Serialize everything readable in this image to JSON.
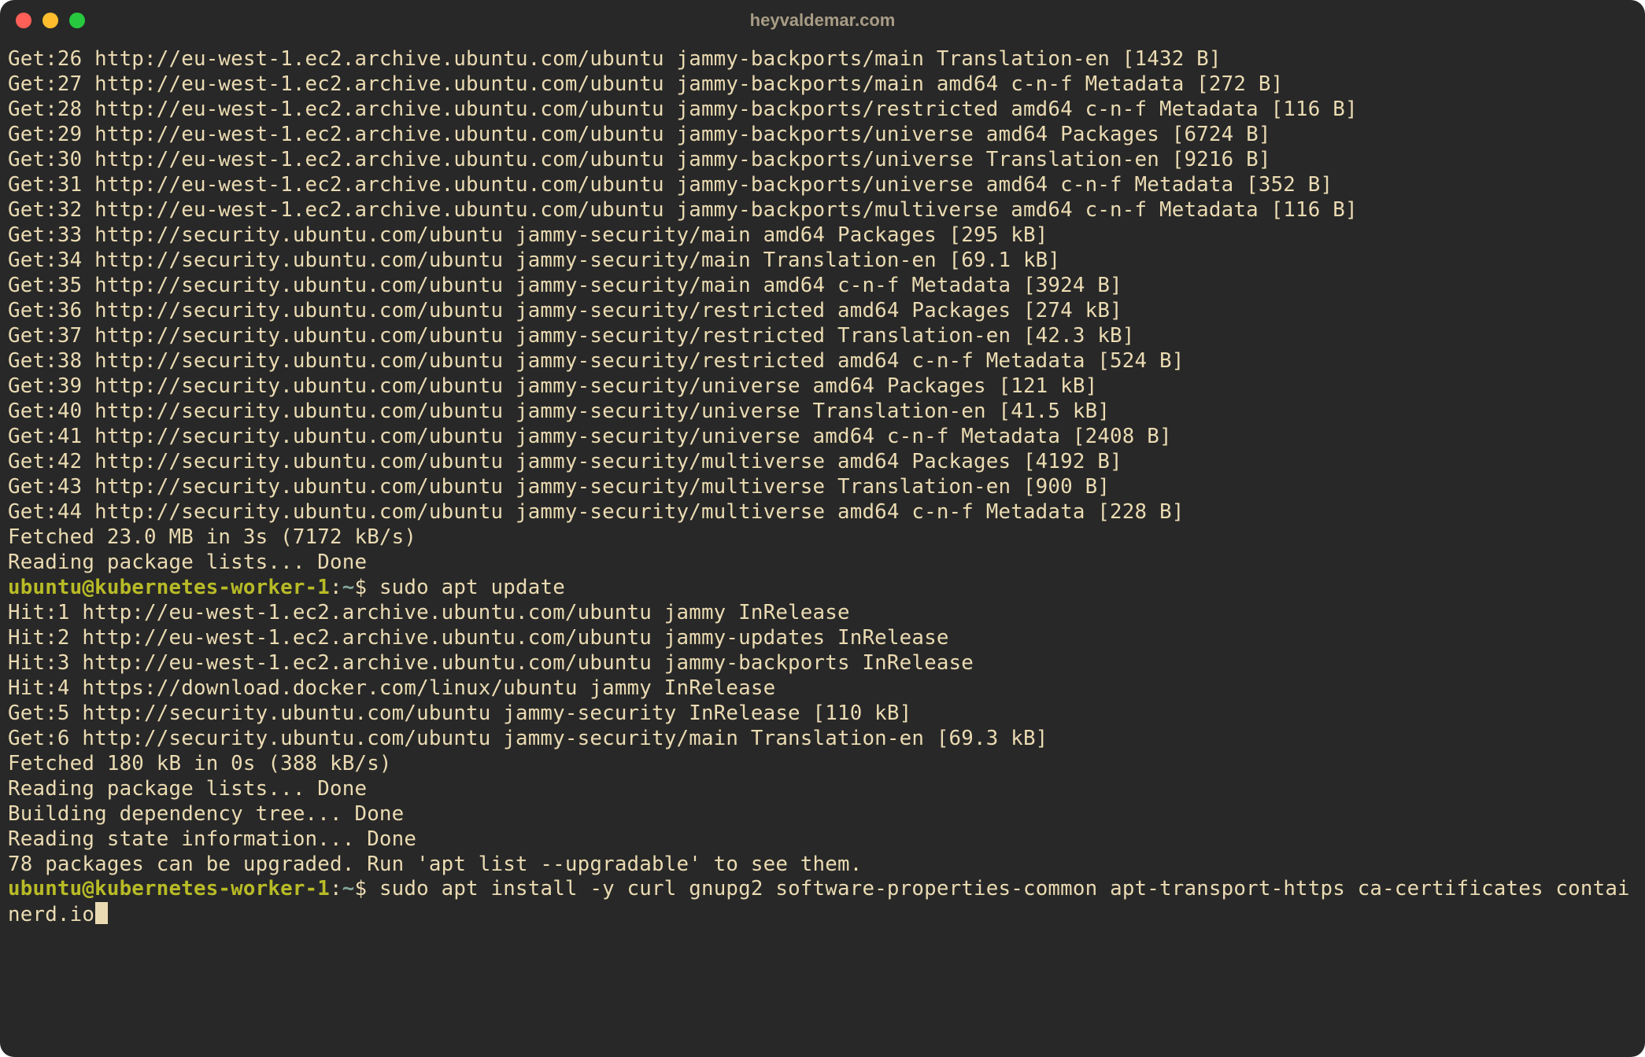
{
  "window": {
    "title": "heyvaldemar.com"
  },
  "prompt": {
    "user_host": "ubuntu@kubernetes-worker-1",
    "colon": ":",
    "path": "~",
    "symbol": "$"
  },
  "lines": [
    {
      "t": "out",
      "text": "Get:26 http://eu-west-1.ec2.archive.ubuntu.com/ubuntu jammy-backports/main Translation-en [1432 B]"
    },
    {
      "t": "out",
      "text": "Get:27 http://eu-west-1.ec2.archive.ubuntu.com/ubuntu jammy-backports/main amd64 c-n-f Metadata [272 B]"
    },
    {
      "t": "out",
      "text": "Get:28 http://eu-west-1.ec2.archive.ubuntu.com/ubuntu jammy-backports/restricted amd64 c-n-f Metadata [116 B]"
    },
    {
      "t": "out",
      "text": "Get:29 http://eu-west-1.ec2.archive.ubuntu.com/ubuntu jammy-backports/universe amd64 Packages [6724 B]"
    },
    {
      "t": "out",
      "text": "Get:30 http://eu-west-1.ec2.archive.ubuntu.com/ubuntu jammy-backports/universe Translation-en [9216 B]"
    },
    {
      "t": "out",
      "text": "Get:31 http://eu-west-1.ec2.archive.ubuntu.com/ubuntu jammy-backports/universe amd64 c-n-f Metadata [352 B]"
    },
    {
      "t": "out",
      "text": "Get:32 http://eu-west-1.ec2.archive.ubuntu.com/ubuntu jammy-backports/multiverse amd64 c-n-f Metadata [116 B]"
    },
    {
      "t": "out",
      "text": "Get:33 http://security.ubuntu.com/ubuntu jammy-security/main amd64 Packages [295 kB]"
    },
    {
      "t": "out",
      "text": "Get:34 http://security.ubuntu.com/ubuntu jammy-security/main Translation-en [69.1 kB]"
    },
    {
      "t": "out",
      "text": "Get:35 http://security.ubuntu.com/ubuntu jammy-security/main amd64 c-n-f Metadata [3924 B]"
    },
    {
      "t": "out",
      "text": "Get:36 http://security.ubuntu.com/ubuntu jammy-security/restricted amd64 Packages [274 kB]"
    },
    {
      "t": "out",
      "text": "Get:37 http://security.ubuntu.com/ubuntu jammy-security/restricted Translation-en [42.3 kB]"
    },
    {
      "t": "out",
      "text": "Get:38 http://security.ubuntu.com/ubuntu jammy-security/restricted amd64 c-n-f Metadata [524 B]"
    },
    {
      "t": "out",
      "text": "Get:39 http://security.ubuntu.com/ubuntu jammy-security/universe amd64 Packages [121 kB]"
    },
    {
      "t": "out",
      "text": "Get:40 http://security.ubuntu.com/ubuntu jammy-security/universe Translation-en [41.5 kB]"
    },
    {
      "t": "out",
      "text": "Get:41 http://security.ubuntu.com/ubuntu jammy-security/universe amd64 c-n-f Metadata [2408 B]"
    },
    {
      "t": "out",
      "text": "Get:42 http://security.ubuntu.com/ubuntu jammy-security/multiverse amd64 Packages [4192 B]"
    },
    {
      "t": "out",
      "text": "Get:43 http://security.ubuntu.com/ubuntu jammy-security/multiverse Translation-en [900 B]"
    },
    {
      "t": "out",
      "text": "Get:44 http://security.ubuntu.com/ubuntu jammy-security/multiverse amd64 c-n-f Metadata [228 B]"
    },
    {
      "t": "out",
      "text": "Fetched 23.0 MB in 3s (7172 kB/s)"
    },
    {
      "t": "out",
      "text": "Reading package lists... Done"
    },
    {
      "t": "prompt",
      "cmd": "sudo apt update"
    },
    {
      "t": "out",
      "text": "Hit:1 http://eu-west-1.ec2.archive.ubuntu.com/ubuntu jammy InRelease"
    },
    {
      "t": "out",
      "text": "Hit:2 http://eu-west-1.ec2.archive.ubuntu.com/ubuntu jammy-updates InRelease"
    },
    {
      "t": "out",
      "text": "Hit:3 http://eu-west-1.ec2.archive.ubuntu.com/ubuntu jammy-backports InRelease"
    },
    {
      "t": "out",
      "text": "Hit:4 https://download.docker.com/linux/ubuntu jammy InRelease"
    },
    {
      "t": "out",
      "text": "Get:5 http://security.ubuntu.com/ubuntu jammy-security InRelease [110 kB]"
    },
    {
      "t": "out",
      "text": "Get:6 http://security.ubuntu.com/ubuntu jammy-security/main Translation-en [69.3 kB]"
    },
    {
      "t": "out",
      "text": "Fetched 180 kB in 0s (388 kB/s)"
    },
    {
      "t": "out",
      "text": "Reading package lists... Done"
    },
    {
      "t": "out",
      "text": "Building dependency tree... Done"
    },
    {
      "t": "out",
      "text": "Reading state information... Done"
    },
    {
      "t": "out",
      "text": "78 packages can be upgraded. Run 'apt list --upgradable' to see them."
    },
    {
      "t": "prompt",
      "cmd": "sudo apt install -y curl gnupg2 software-properties-common apt-transport-https ca-certificates containerd.io",
      "cursor": true
    }
  ]
}
